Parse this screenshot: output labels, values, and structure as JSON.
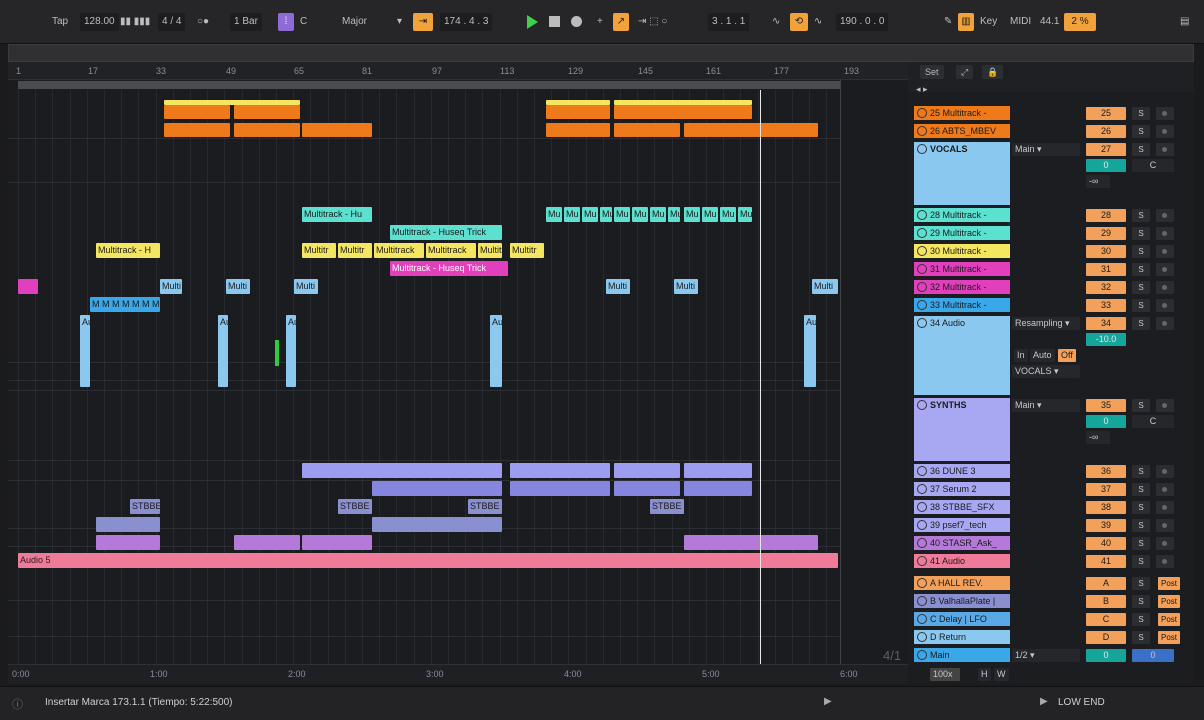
{
  "transport": {
    "tap": "Tap",
    "tempo": "128.00",
    "signature": "4 / 4",
    "quantize": "1 Bar",
    "key_root": "C",
    "scale": "Major",
    "position": "174 .  4 .  3",
    "loop_start": "3 .  1 .  1",
    "loop_length": "190 .  0 .  0",
    "key_label": "Key",
    "midi_label": "MIDI",
    "sample_rate": "44.1",
    "cpu": "2 %"
  },
  "ruler": {
    "bars": [
      "1",
      "17",
      "33",
      "49",
      "65",
      "81",
      "97",
      "113",
      "129",
      "145",
      "161",
      "177",
      "193"
    ],
    "times": [
      "0:00",
      "1:00",
      "2:00",
      "3:00",
      "4:00",
      "5:00",
      "6:00"
    ]
  },
  "zoom_indicator": "4/1",
  "clips": {
    "yellow_a": "Multitrack - H",
    "yellow_b": "Multitr",
    "yellow_c": "Multitr",
    "yellow_d": "Multitrack",
    "yellow_e": "Multitrack",
    "yellow_f": "Multit",
    "yellow_g": "Multitr",
    "cyan_a": "Multitrack - Hu",
    "cyan_b": "Multitrack - Huseq Trick",
    "cyan_small": "Mu",
    "magenta_a": "Multitrack - Huseq Trick",
    "ltblue": "Multi",
    "blue_m": "M M M M M M M",
    "audio_short": "Au",
    "stbbe": "STBBE",
    "audio5": "Audio 5"
  },
  "session_header": {
    "set": "Set"
  },
  "tracks": [
    {
      "name": "25 Multitrack -",
      "num": "25",
      "color": "#ee7a1c"
    },
    {
      "name": "26 ABTS_MBEV",
      "num": "26",
      "color": "#ee7a1c"
    },
    {
      "name": "VOCALS",
      "num": "27",
      "color": "#8bc8f0",
      "output": "Main"
    },
    {
      "name": "28 Multitrack -",
      "num": "28",
      "color": "#5ce0d0"
    },
    {
      "name": "29 Multitrack -",
      "num": "29",
      "color": "#5ce0d0"
    },
    {
      "name": "30 Multitrack -",
      "num": "30",
      "color": "#f5e662"
    },
    {
      "name": "31 Multitrack -",
      "num": "31",
      "color": "#e23fbd"
    },
    {
      "name": "32 Multitrack -",
      "num": "32",
      "color": "#e23fbd"
    },
    {
      "name": "33 Multitrack -",
      "num": "33",
      "color": "#3aa7e8"
    },
    {
      "name": "34 Audio",
      "num": "34",
      "color": "#8bc8f0",
      "input": "Resampling"
    },
    {
      "name": "SYNTHS",
      "num": "35",
      "color": "#a8a8f2",
      "output": "Main"
    },
    {
      "name": "36 DUNE 3",
      "num": "36",
      "color": "#a8a8f2"
    },
    {
      "name": "37 Serum 2",
      "num": "37",
      "color": "#a8a8f2"
    },
    {
      "name": "38 STBBE_SFX",
      "num": "38",
      "color": "#a8a8f2"
    },
    {
      "name": "39 psef7_tech",
      "num": "39",
      "color": "#a8a8f2"
    },
    {
      "name": "40 STASR_Ask_",
      "num": "40",
      "color": "#b57ad9"
    },
    {
      "name": "41 Audio",
      "num": "41",
      "color": "#f07a9a"
    }
  ],
  "returns": [
    {
      "name": "A HALL REV.",
      "letter": "A",
      "color": "#f3a15a"
    },
    {
      "name": "B ValhallaPlate |",
      "letter": "B",
      "color": "#8a8fd0"
    },
    {
      "name": "C Delay | LFO",
      "letter": "C",
      "color": "#5aa9e6"
    },
    {
      "name": "D Return",
      "letter": "D",
      "color": "#8bc8f0"
    }
  ],
  "main": {
    "name": "Main",
    "ratio": "1/2",
    "vol": "0",
    "pan": "0"
  },
  "mixer_labels": {
    "solo": "S",
    "post": "Post",
    "zero": "0",
    "center": "C",
    "neg_inf": "-∞",
    "in": "In",
    "auto": "Auto",
    "off": "Off",
    "vocals_route": "VOCALS",
    "vol_neg": "-10.0",
    "scale_100": "100x",
    "h": "H",
    "w": "W"
  },
  "status": {
    "text": "Insertar Marca 173.1.1 (Tiempo: 5:22:500)",
    "low_end": "LOW END"
  }
}
